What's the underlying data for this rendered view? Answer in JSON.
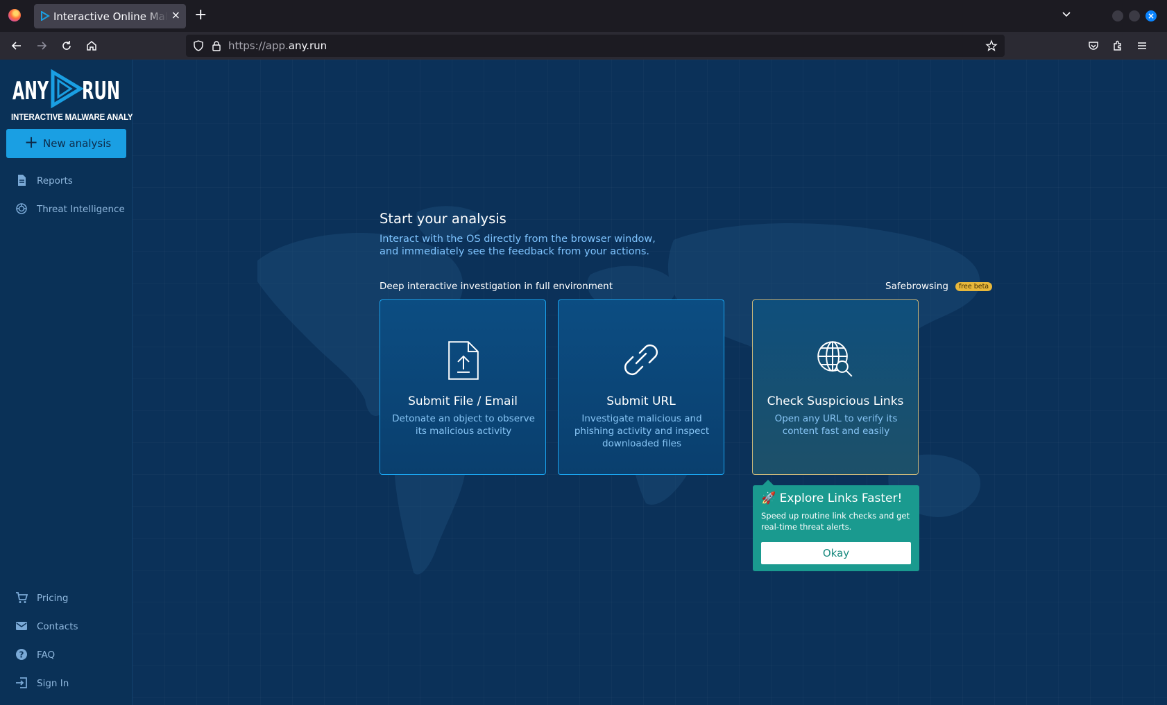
{
  "browser": {
    "tab_title": "Interactive Online Malware Analysis Sandbox",
    "tab_close": "×",
    "new_tab": "+",
    "url_prefix": "https://app.",
    "url_domain": "any.run"
  },
  "brand": {
    "name_left": "ANY",
    "name_right": "RUN",
    "tagline": "INTERACTIVE MALWARE ANALYSIS",
    "accent": "#1a9fe3"
  },
  "sidebar": {
    "new_analysis_icon": "+",
    "new_analysis_label": "New analysis",
    "top_items": [
      {
        "label": "Reports",
        "icon": "document-icon"
      },
      {
        "label": "Threat Intelligence",
        "icon": "radar-icon"
      }
    ],
    "bottom_items": [
      {
        "label": "Pricing",
        "icon": "cart-icon"
      },
      {
        "label": "Contacts",
        "icon": "mail-icon"
      },
      {
        "label": "FAQ",
        "icon": "help-icon"
      },
      {
        "label": "Sign In",
        "icon": "sign-in-icon"
      }
    ]
  },
  "main": {
    "heading": "Start your analysis",
    "subheading_line1": "Interact with the OS directly from the browser window,",
    "subheading_line2": "and immediately see the feedback from your actions.",
    "group_interactive": "Deep interactive investigation in full environment",
    "group_safebrowsing": "Safebrowsing",
    "safebrowsing_badge": "free beta",
    "cards": [
      {
        "title": "Submit File / Email",
        "description": "Detonate an object to observe its malicious activity",
        "icon": "file-upload-icon"
      },
      {
        "title": "Submit URL",
        "description": "Investigate malicious and phishing activity and inspect downloaded files",
        "icon": "link-icon"
      },
      {
        "title": "Check Suspicious Links",
        "description": "Open any URL to verify its content fast and easily",
        "icon": "globe-search-icon"
      }
    ]
  },
  "popover": {
    "emoji": "🚀",
    "title": "Explore Links Faster!",
    "text": "Speed up routine link checks and get real-time threat alerts.",
    "button": "Okay"
  }
}
